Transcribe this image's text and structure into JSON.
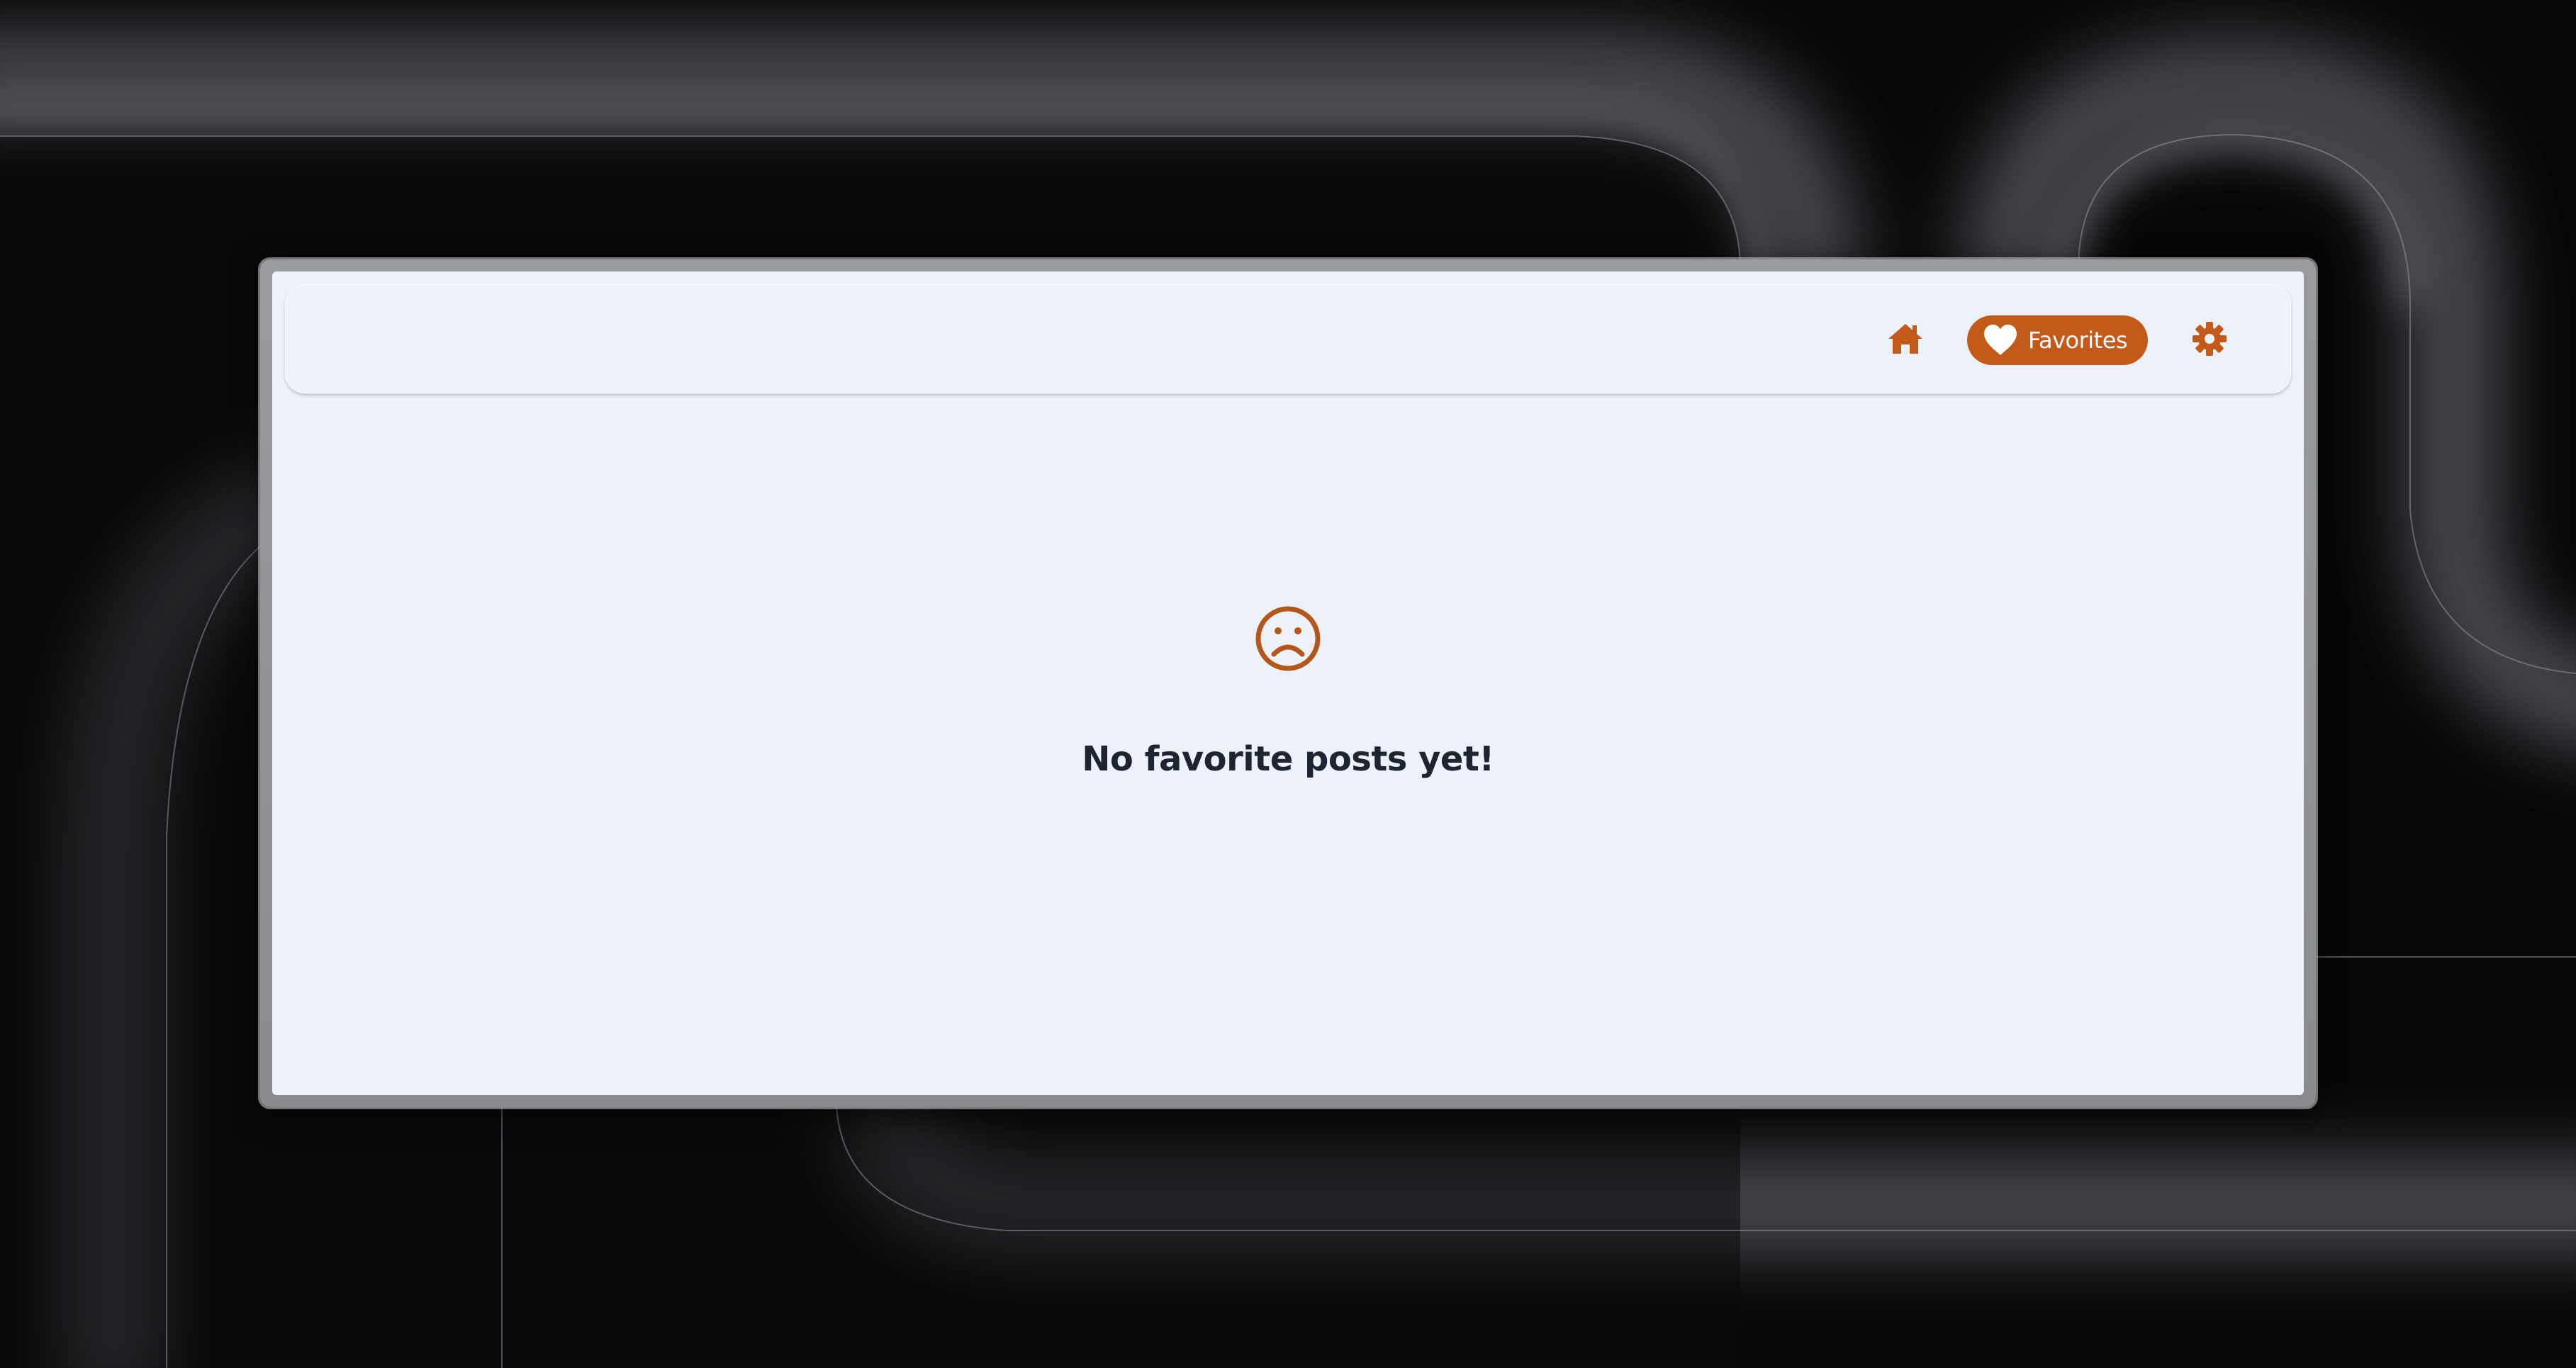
{
  "colors": {
    "accent": "#c45a1a",
    "page_background": "#edf2f9",
    "text_primary": "#1f2433"
  },
  "navbar": {
    "home": {
      "icon": "home-icon"
    },
    "favorites": {
      "icon": "heart-icon",
      "label": "Favorites",
      "active": true
    },
    "settings": {
      "icon": "gear-icon"
    }
  },
  "empty_state": {
    "icon": "sad-face-icon",
    "message": "No favorite posts yet!"
  }
}
